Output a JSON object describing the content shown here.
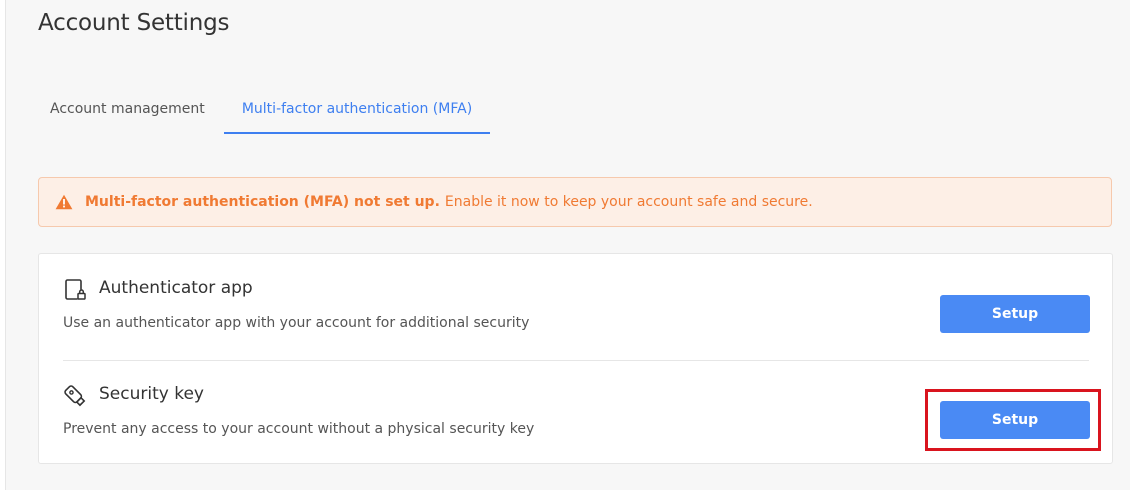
{
  "page": {
    "title": "Account Settings"
  },
  "tabs": [
    {
      "label": "Account management",
      "active": false
    },
    {
      "label": "Multi-factor authentication (MFA)",
      "active": true
    }
  ],
  "alert": {
    "icon": "warning-triangle-icon",
    "bold_text": "Multi-factor authentication (MFA) not set up.",
    "text": "Enable it now to keep your account safe and secure.",
    "color": "#f07a33"
  },
  "methods": [
    {
      "icon": "authenticator-device-icon",
      "title": "Authenticator app",
      "description": "Use an authenticator app with your account for additional security",
      "button_label": "Setup"
    },
    {
      "icon": "security-key-icon",
      "title": "Security key",
      "description": "Prevent any access to your account without a physical security key",
      "button_label": "Setup"
    }
  ],
  "colors": {
    "accent": "#4a8af4",
    "tab_active": "#3e7ff0",
    "highlight": "#d9141e"
  }
}
